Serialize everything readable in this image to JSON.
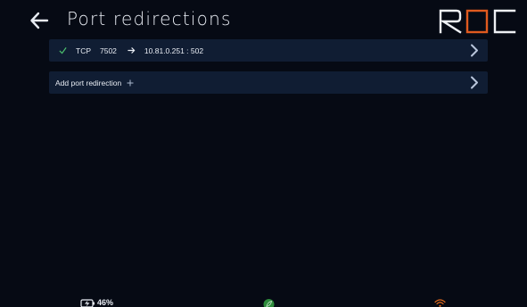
{
  "header": {
    "title": "Port redirections",
    "logo_text": "ROC"
  },
  "redirections": [
    {
      "protocol": "TCP",
      "port": "7502",
      "destination": "10.81.0.251 : 502"
    }
  ],
  "add_label": "Add port redirection",
  "status": {
    "battery": "46%"
  },
  "colors": {
    "background": "#060a14",
    "row": "#101d33",
    "check": "#4cc26e",
    "logo_accent": "#e05a1f",
    "leaf": "#2e8b3c",
    "wifi": "#e06a1f",
    "chevron": "#b9c6dc"
  },
  "icons": [
    "back-arrow-icon",
    "check-icon",
    "arrow-right-icon",
    "chevron-right-icon",
    "plus-icon",
    "battery-charging-icon",
    "leaf-icon",
    "wifi-icon"
  ]
}
